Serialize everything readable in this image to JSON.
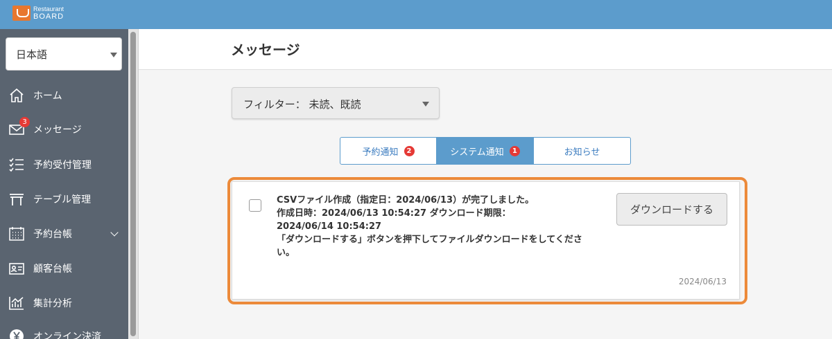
{
  "brand": {
    "line1": "Restaurant",
    "line2": "BOARD"
  },
  "sidebar": {
    "language": "日本語",
    "items": [
      {
        "label": "ホーム",
        "icon": "home-icon"
      },
      {
        "label": "メッセージ",
        "icon": "mail-icon",
        "badge": "3"
      },
      {
        "label": "予約受付管理",
        "icon": "checklist-icon"
      },
      {
        "label": "テーブル管理",
        "icon": "table-icon"
      },
      {
        "label": "予約台帳",
        "icon": "calendar-icon",
        "has_submenu": true
      },
      {
        "label": "顧客台帳",
        "icon": "id-card-icon"
      },
      {
        "label": "集計分析",
        "icon": "chart-icon"
      },
      {
        "label": "オンライン決済",
        "icon": "yen-icon"
      }
    ]
  },
  "page": {
    "title": "メッセージ"
  },
  "filter": {
    "label": "フィルター： 未読、既読"
  },
  "tabs": [
    {
      "label": "予約通知",
      "badge": "2",
      "active": false
    },
    {
      "label": "システム通知",
      "badge": "1",
      "active": true
    },
    {
      "label": "お知らせ",
      "badge": "",
      "active": false
    }
  ],
  "message": {
    "line1": "CSVファイル作成（指定日：2024/06/13）が完了しました。",
    "line2": "作成日時：2024/06/13 10:54:27 ダウンロード期限：",
    "line3": "2024/06/14 10:54:27",
    "line4": "「ダウンロードする」ボタンを押下してファイルダウンロードをしてくださ",
    "line5": "い。",
    "button": "ダウンロードする",
    "date": "2024/06/13"
  },
  "colors": {
    "header": "#5c9ccc",
    "sidebar": "#5a6470",
    "highlight": "#ec8a3a",
    "badge": "#e53935"
  }
}
